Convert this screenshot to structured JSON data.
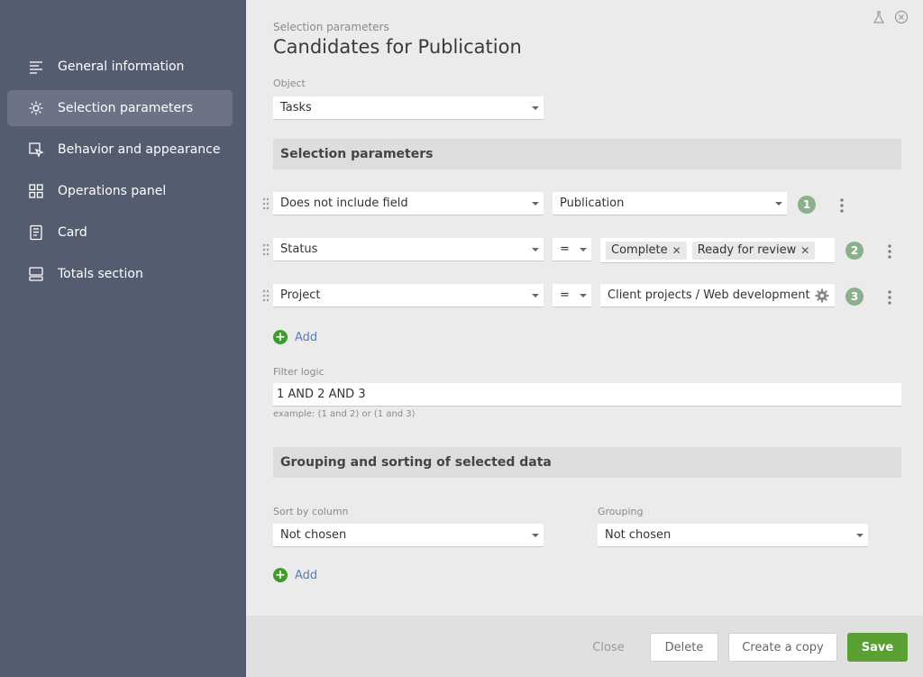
{
  "sidebar": {
    "items": [
      {
        "label": "General information",
        "icon": "list-lines-icon"
      },
      {
        "label": "Selection parameters",
        "icon": "gear-icon",
        "active": true
      },
      {
        "label": "Behavior and appearance",
        "icon": "cursor-icon"
      },
      {
        "label": "Operations panel",
        "icon": "grid-icon"
      },
      {
        "label": "Card",
        "icon": "card-icon"
      },
      {
        "label": "Totals section",
        "icon": "totals-icon"
      }
    ]
  },
  "header": {
    "breadcrumb": "Selection parameters",
    "title": "Candidates for Publication"
  },
  "object": {
    "label": "Object",
    "value": "Tasks"
  },
  "selection": {
    "section_title": "Selection parameters",
    "rows": [
      {
        "field": "Does not include field",
        "value": "Publication",
        "number": "1"
      },
      {
        "field": "Status",
        "operator": "=",
        "tags": [
          "Complete",
          "Ready for review"
        ],
        "number": "2"
      },
      {
        "field": "Project",
        "operator": "=",
        "value": "Client projects / Web development",
        "number": "3"
      }
    ],
    "add_label": "Add"
  },
  "filter_logic": {
    "label": "Filter logic",
    "value": "1 AND 2 AND 3",
    "hint": "example: (1 and 2) or (1 and 3)"
  },
  "grouping": {
    "section_title": "Grouping and sorting of selected data",
    "sort_label": "Sort by column",
    "sort_value": "Not chosen",
    "group_label": "Grouping",
    "group_value": "Not chosen",
    "add_label": "Add"
  },
  "footer": {
    "close": "Close",
    "delete": "Delete",
    "copy": "Create a copy",
    "save": "Save"
  },
  "colors": {
    "sidebar_bg": "#545d70",
    "sidebar_active": "#6b7384",
    "accent_green": "#5aa032",
    "badge_green": "#8daf8e",
    "link_blue": "#5a7bb5"
  }
}
